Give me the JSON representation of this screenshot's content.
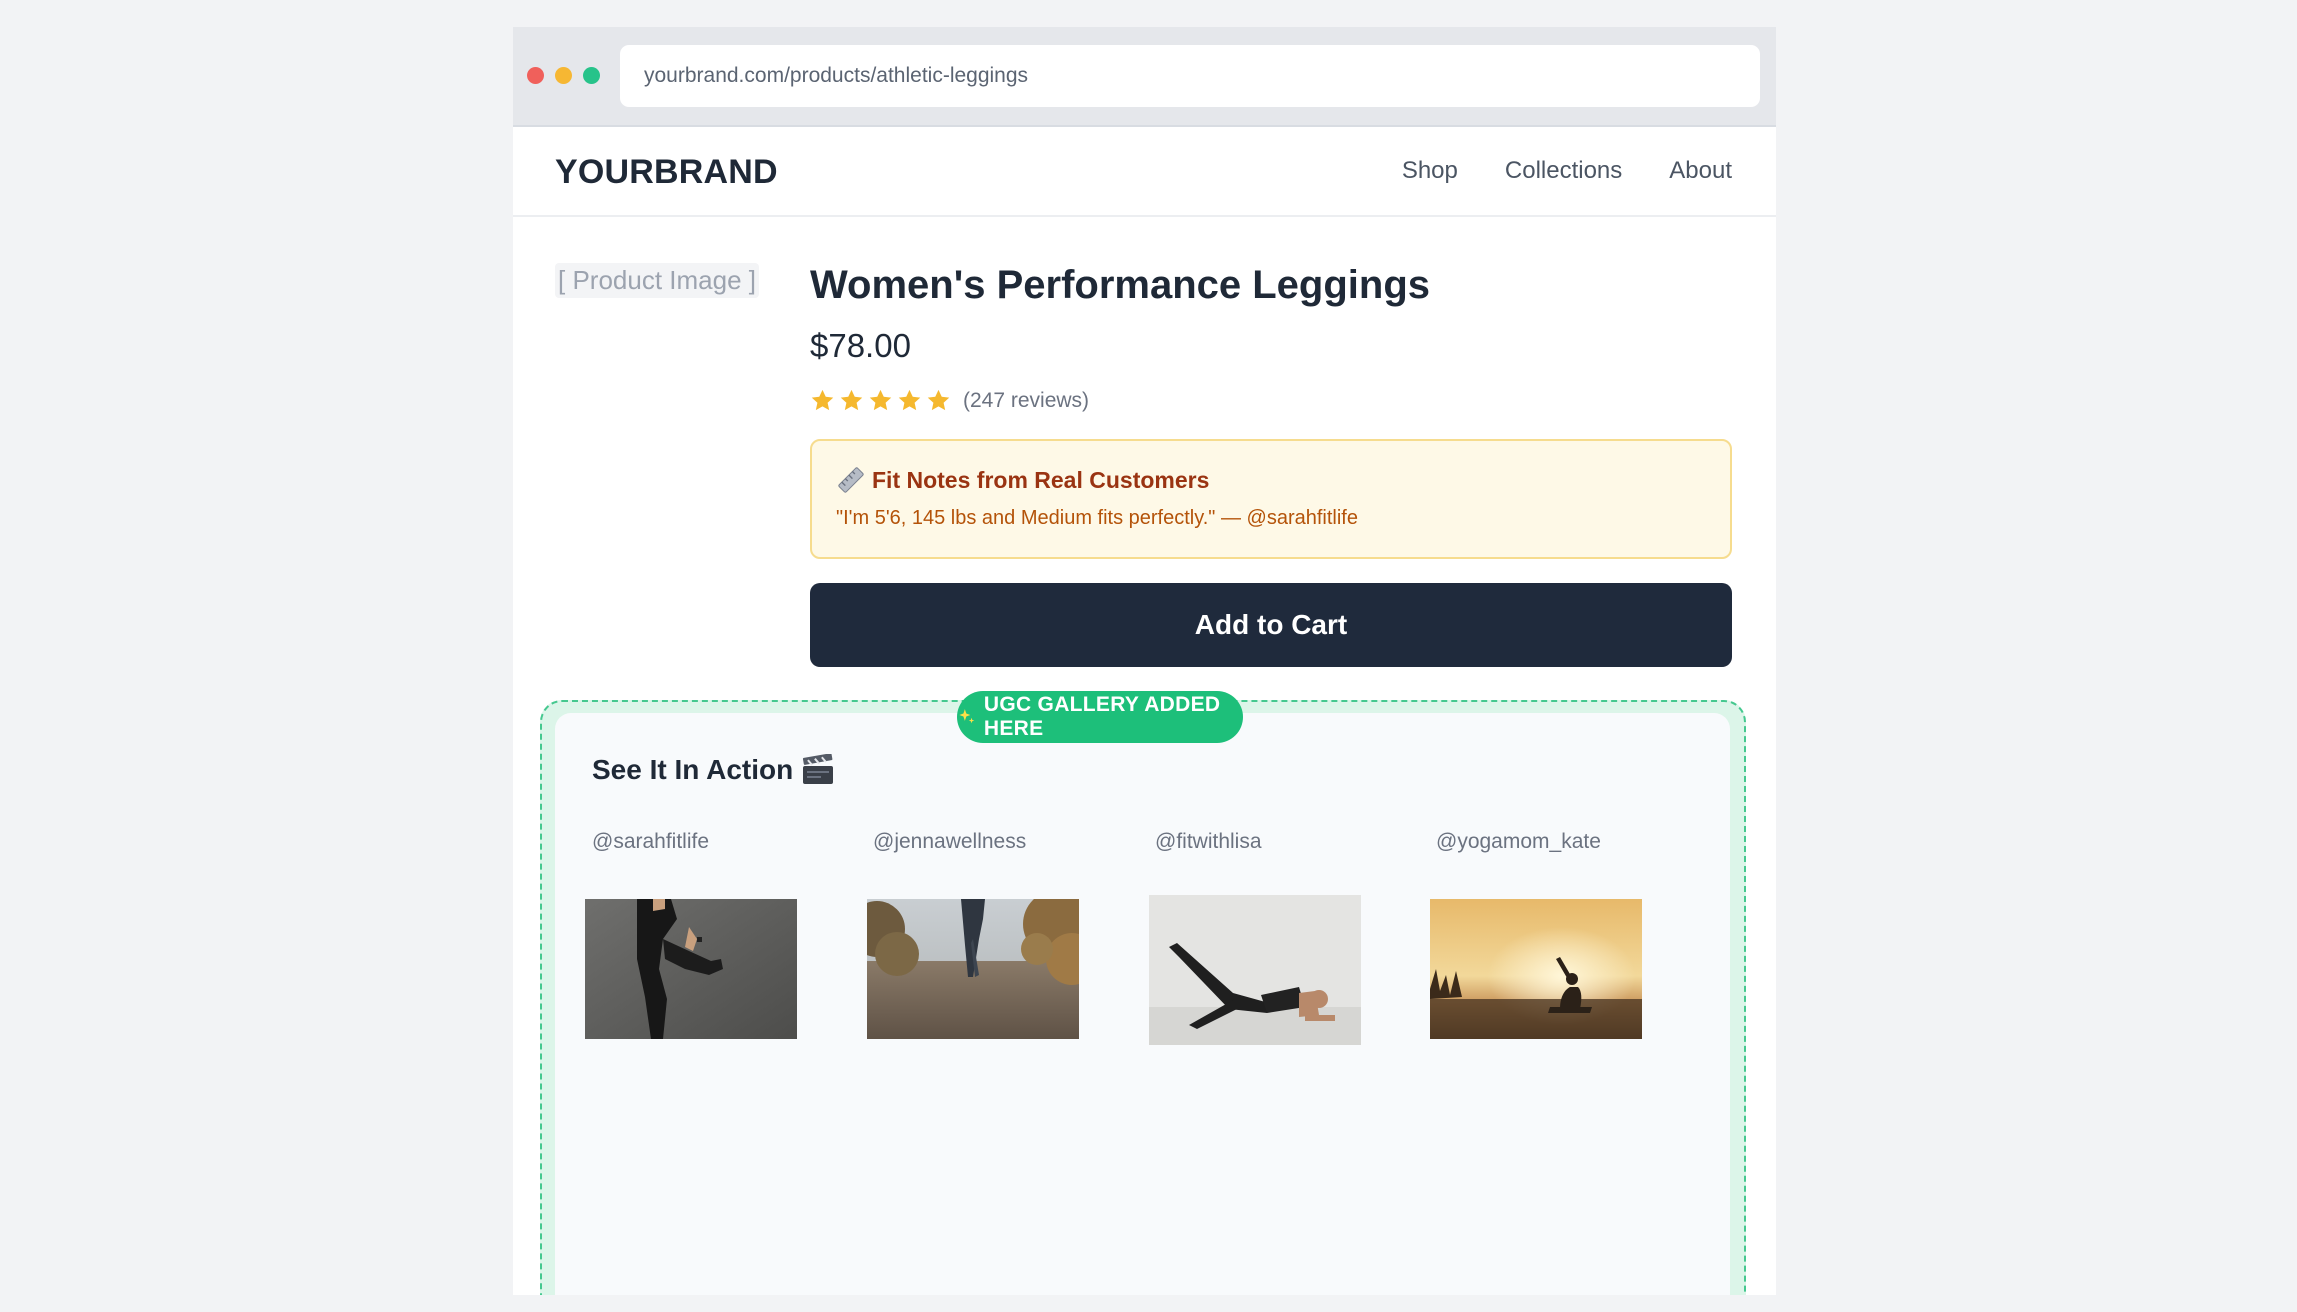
{
  "browser": {
    "url": "yourbrand.com/products/athletic-leggings"
  },
  "nav": {
    "brand": "YOURBRAND",
    "links": [
      "Shop",
      "Collections",
      "About"
    ]
  },
  "product": {
    "image_placeholder": "[ Product Image ]",
    "title": "Women's Performance Leggings",
    "price": "$78.00",
    "rating_stars": 5,
    "reviews": "(247 reviews)",
    "fit_notes": {
      "icon": "ruler-icon",
      "title": "Fit Notes from Real Customers",
      "quote": "\"I'm 5'6, 145 lbs and Medium fits perfectly.\" — @sarahfitlife"
    },
    "add_to_cart_label": "Add to Cart"
  },
  "ugc": {
    "badge": "UGC GALLERY ADDED HERE",
    "heading": "See It In Action",
    "items": [
      {
        "handle": "@sarahfitlife"
      },
      {
        "handle": "@jennawellness"
      },
      {
        "handle": "@fitwithlisa"
      },
      {
        "handle": "@yogamom_kate"
      }
    ]
  },
  "colors": {
    "accent_green": "#1dbf7a",
    "button_dark": "#1f2a3c",
    "star_gold": "#f5b82e",
    "note_bg": "#fef9e7",
    "note_text": "#9a3412"
  }
}
